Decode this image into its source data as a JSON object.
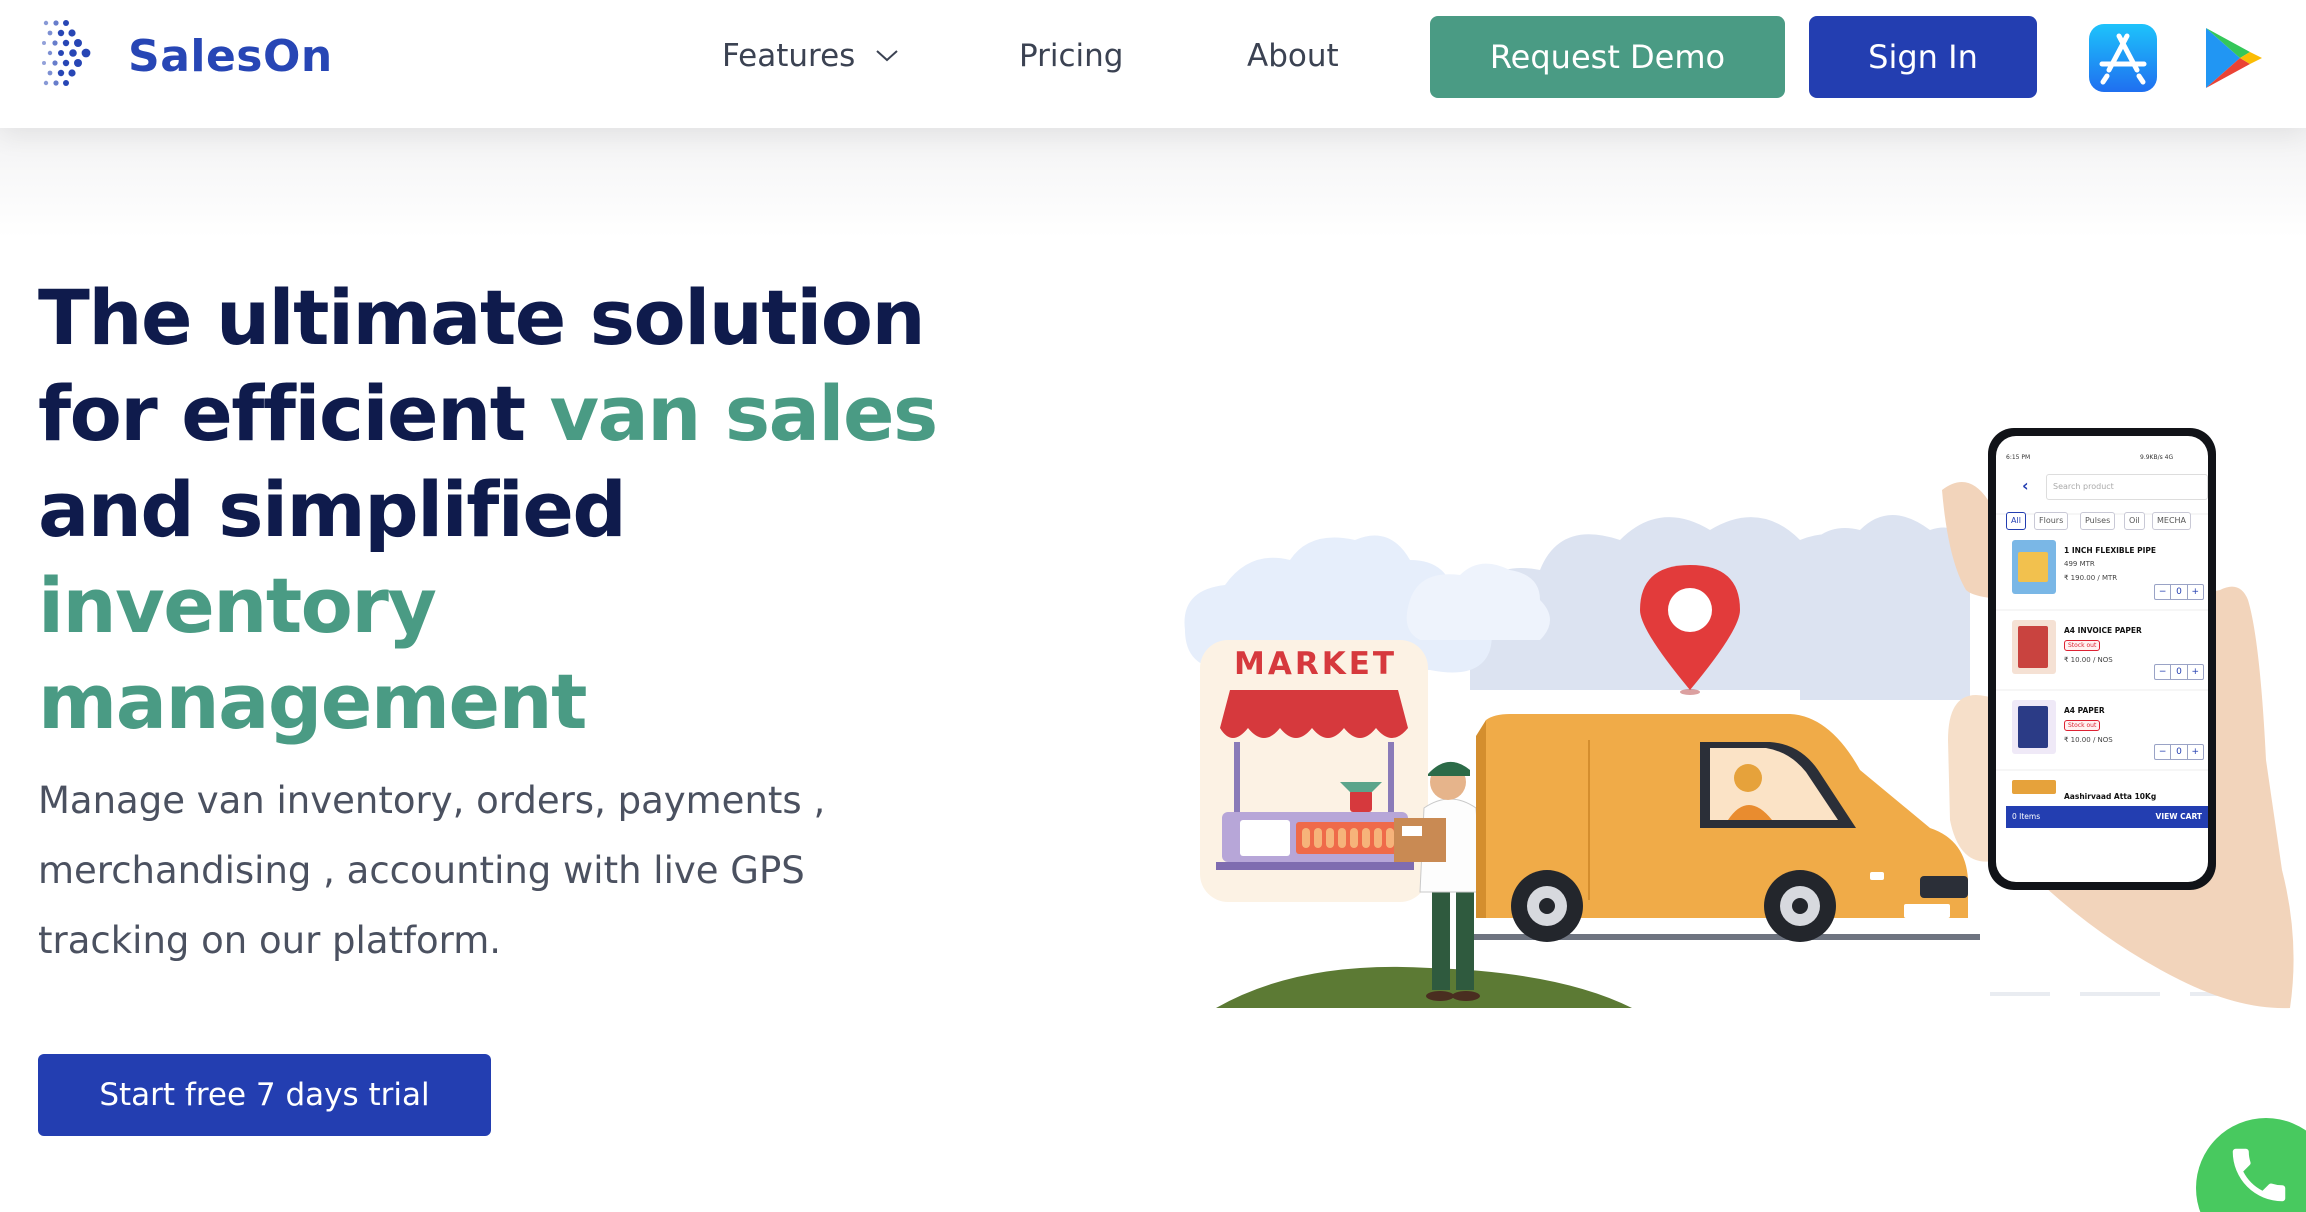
{
  "brand": {
    "name": "SalesOn"
  },
  "nav": {
    "features": "Features",
    "pricing": "Pricing",
    "about": "About",
    "request_demo": "Request Demo",
    "sign_in": "Sign In",
    "app_store_icon": "app-store-icon",
    "play_store_icon": "google-play-icon"
  },
  "hero": {
    "headline_part1": "The ultimate solution for efficient ",
    "headline_green1": "van sales",
    "headline_part2": " and simplified ",
    "headline_green2": "inventory management",
    "subtitle": "Manage van inventory, orders, payments , merchandising , accounting with live GPS tracking on our platform.",
    "cta": "Start free 7 days trial"
  },
  "illustration": {
    "market_sign": "MARKET",
    "phone": {
      "status_time": "6:15 PM",
      "status_right": "9.9KB/s 4G",
      "search_placeholder": "Search product",
      "categories": [
        "All",
        "Flours",
        "Pulses",
        "Oil",
        "MECHA"
      ],
      "products": [
        {
          "name": "1 INCH FLEXIBLE PIPE",
          "stock": "499 MTR",
          "price": "₹ 190.00 / MTR",
          "qty": "0"
        },
        {
          "name": "A4 INVOICE PAPER",
          "stock": "Stock out",
          "price": "₹ 10.00 / NOS",
          "qty": "0"
        },
        {
          "name": "A4 PAPER",
          "stock": "Stock out",
          "price": "₹ 10.00 / NOS",
          "qty": "0"
        }
      ],
      "last_product": "Aashirvaad Atta 10Kg",
      "cart_items": "0 Items",
      "view_cart": "VIEW CART"
    }
  },
  "colors": {
    "navy": "#0f1b4c",
    "green": "#4a9b84",
    "blue": "#233eb1",
    "van": "#f0ab48",
    "pin": "#e23b3b",
    "whatsapp": "#48c95f"
  },
  "icons": {
    "features_dropdown": "chevron-down-icon",
    "floating_call": "phone-icon"
  }
}
